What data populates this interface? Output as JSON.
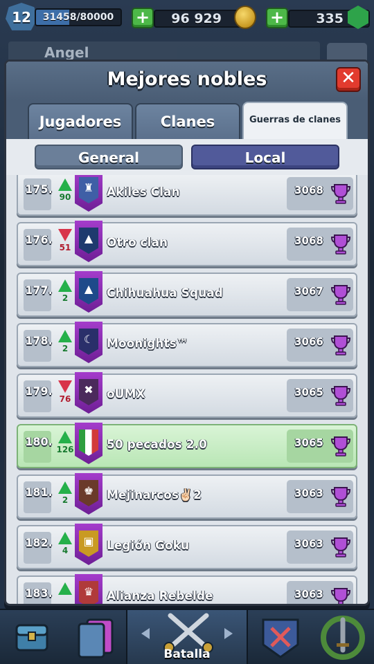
{
  "topbar": {
    "level": "12",
    "xp_text": "31458/80000",
    "xp_fraction": 0.393,
    "gold": "96 929",
    "gems": "335",
    "plus_label": "+"
  },
  "background": {
    "player_name": "Angel"
  },
  "modal": {
    "title": "Mejores nobles",
    "close_label": "✕",
    "tabs": [
      {
        "label": "Jugadores",
        "active": false
      },
      {
        "label": "Clanes",
        "active": false
      },
      {
        "label": "Guerras de clanes",
        "active": true
      }
    ],
    "toggle": {
      "general_label": "General",
      "local_label": "Local",
      "selected": "Local"
    }
  },
  "rows": [
    {
      "rank": "175.",
      "direction": "up",
      "change": "90",
      "name": "Akiles Clan",
      "score": "3068",
      "badge_color": "#3f5fa6",
      "badge_symbol": "♜",
      "highlight": false
    },
    {
      "rank": "176.",
      "direction": "down",
      "change": "51",
      "name": "Otro clan",
      "score": "3068",
      "badge_color": "#1e3a6e",
      "badge_symbol": "▲",
      "highlight": false
    },
    {
      "rank": "177.",
      "direction": "up",
      "change": "2",
      "name": "Chihuahua Squad",
      "score": "3067",
      "badge_color": "#1e4a8a",
      "badge_symbol": "▲",
      "highlight": false
    },
    {
      "rank": "178.",
      "direction": "up",
      "change": "2",
      "name": "Moonights™",
      "score": "3066",
      "badge_color": "#2a2f6a",
      "badge_symbol": "☾",
      "highlight": false
    },
    {
      "rank": "179.",
      "direction": "down",
      "change": "76",
      "name": "oUMX",
      "score": "3065",
      "badge_color": "#4b2a5c",
      "badge_symbol": "✖",
      "highlight": false
    },
    {
      "rank": "180.",
      "direction": "up",
      "change": "126",
      "name": "50 pecados 2.0",
      "score": "3065",
      "badge_color": "#ffffff",
      "badge_symbol": "▮",
      "highlight": true
    },
    {
      "rank": "181.",
      "direction": "up",
      "change": "2",
      "name": "Mejinarcos✌🏻2",
      "score": "3063",
      "badge_color": "#6a3a2a",
      "badge_symbol": "♚",
      "highlight": false
    },
    {
      "rank": "182.",
      "direction": "up",
      "change": "4",
      "name": "Legión Goku",
      "score": "3063",
      "badge_color": "#c99a23",
      "badge_symbol": "▣",
      "highlight": false
    },
    {
      "rank": "183.",
      "direction": "up",
      "change": "",
      "name": "Alianza Rebelde",
      "score": "3063",
      "badge_color": "#b03a3a",
      "badge_symbol": "♛",
      "highlight": false
    }
  ],
  "bottom_nav": {
    "active_label": "Batalla",
    "items": [
      "shop-chest-icon",
      "cards-icon",
      "battle-swords-icon",
      "clan-shield-icon",
      "tournament-laurel-icon"
    ]
  },
  "colors": {
    "up": "#25b04a",
    "down": "#d8344a",
    "trophy": "#b04fd6",
    "highlight_row": "#c8eec3"
  }
}
